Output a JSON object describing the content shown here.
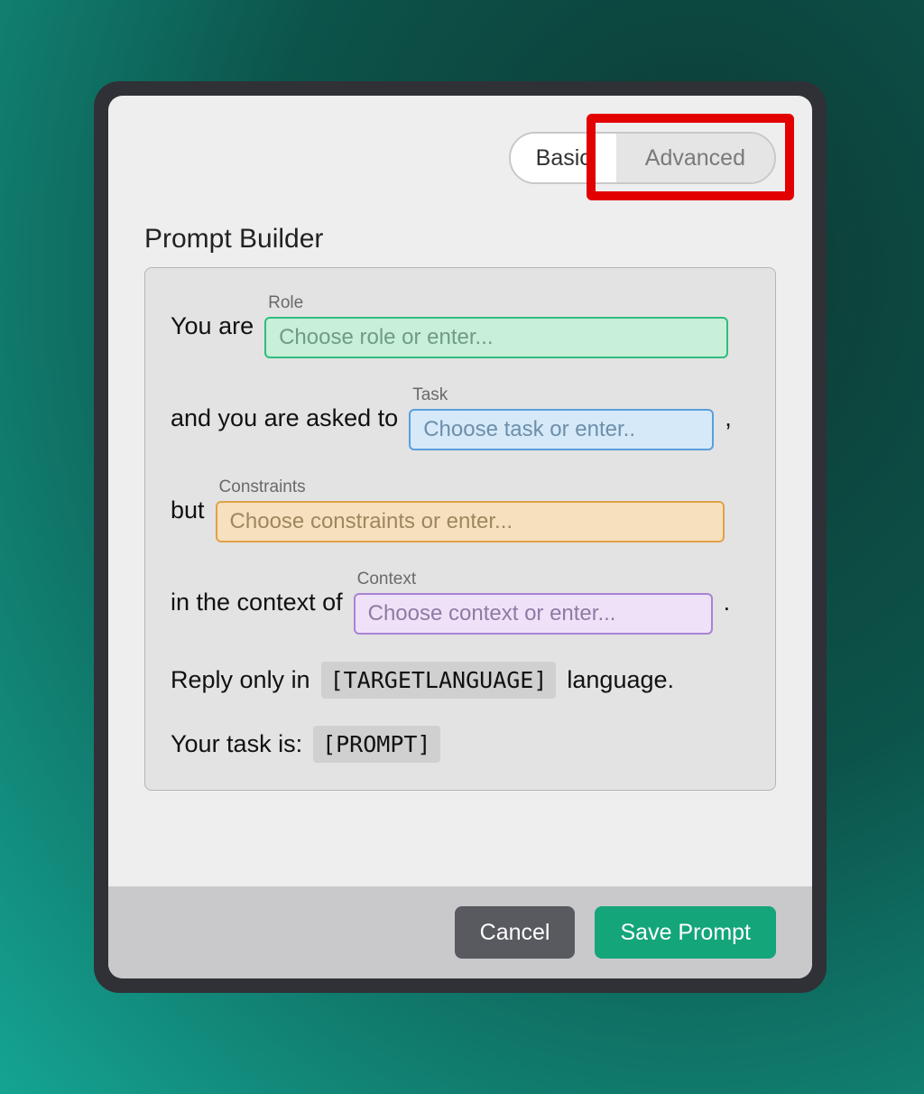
{
  "tabs": {
    "basic": "Basic",
    "advanced": "Advanced"
  },
  "title": "Prompt Builder",
  "row1": {
    "prefix": "You are",
    "label": "Role",
    "placeholder": "Choose role or enter..."
  },
  "row2": {
    "prefix": "and you are asked to",
    "label": "Task",
    "placeholder": "Choose task or enter..",
    "suffix": ","
  },
  "row3": {
    "prefix": "but",
    "label": "Constraints",
    "placeholder": "Choose constraints or enter..."
  },
  "row4": {
    "prefix": "in the context of",
    "label": "Context",
    "placeholder": "Choose context or enter...",
    "suffix": "."
  },
  "row5": {
    "prefix": "Reply only in",
    "chip": "[TARGETLANGUAGE]",
    "suffix": "language."
  },
  "row6": {
    "prefix": "Your task is:",
    "chip": "[PROMPT]"
  },
  "buttons": {
    "cancel": "Cancel",
    "save": "Save Prompt"
  }
}
